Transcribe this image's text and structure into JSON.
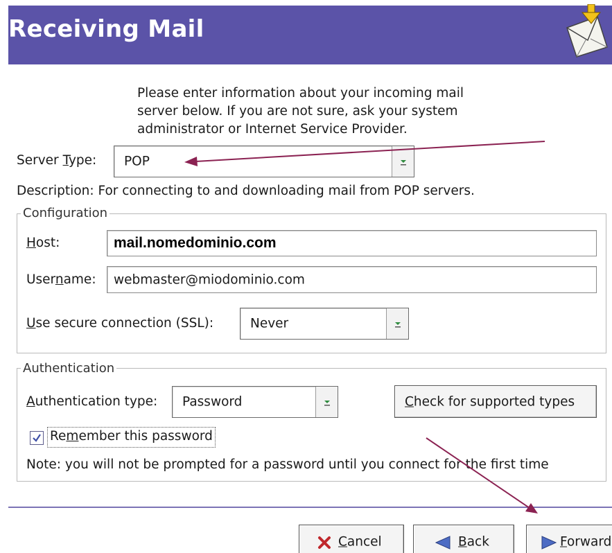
{
  "header": {
    "title": "Receiving Mail",
    "icon": "mail-download-icon",
    "banner_color": "#5b53a8"
  },
  "intro": {
    "lines": [
      "Please enter information about your incoming mail",
      "server below. If you are not sure, ask your system",
      "administrator or Internet Service Provider."
    ]
  },
  "server_type": {
    "label_pre": "Server ",
    "label_mnemonic": "T",
    "label_post": "ype:",
    "value": "POP"
  },
  "description": "Description: For connecting to and downloading mail from POP servers.",
  "configuration": {
    "title": "Configuration",
    "host": {
      "label_mnemonic": "H",
      "label_post": "ost:",
      "value": "mail.nomedominio.com"
    },
    "username": {
      "label_pre": "User",
      "label_mnemonic": "n",
      "label_post": "ame:",
      "value": "webmaster@miodominio.com"
    },
    "ssl": {
      "label_mnemonic": "U",
      "label_post": "se secure connection (SSL):",
      "value": "Never"
    }
  },
  "authentication": {
    "title": "Authentication",
    "type": {
      "label_mnemonic": "A",
      "label_post": "uthentication type:",
      "value": "Password"
    },
    "check_button": {
      "mnemonic": "C",
      "label_post": "heck for supported types"
    },
    "remember": {
      "label_pre": "Re",
      "label_mnemonic": "m",
      "label_post": "ember this password",
      "checked": true
    },
    "note": "Note: you will not be prompted for a password until you connect for the first time"
  },
  "footer": {
    "cancel": {
      "mnemonic": "C",
      "label_post": "ancel",
      "icon": "cancel-x-icon"
    },
    "back": {
      "mnemonic": "B",
      "label_post": "ack",
      "icon": "back-arrow-icon"
    },
    "forward": {
      "mnemonic": "F",
      "label_post": "orward",
      "icon": "forward-arrow-icon"
    }
  },
  "annotation_color": "#8b2252"
}
